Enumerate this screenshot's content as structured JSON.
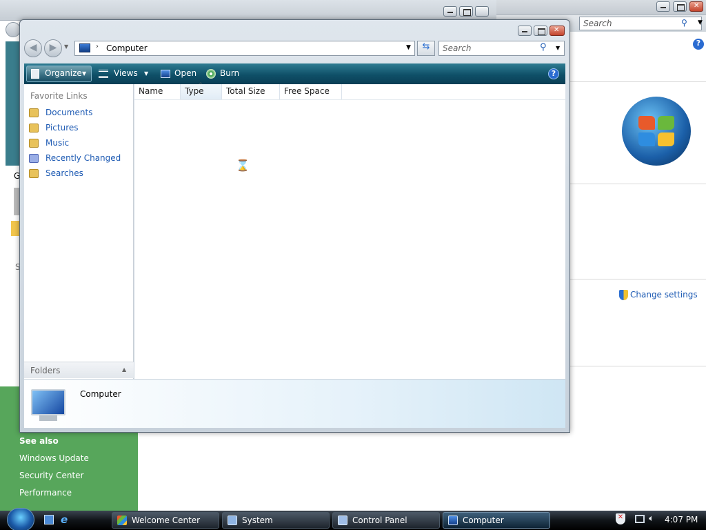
{
  "background_window": {
    "search_placeholder": "Search",
    "change_settings": "Change settings"
  },
  "back_window_left": {
    "letter_g": "G",
    "letter_s": "S"
  },
  "green_panel": {
    "heading": "See also",
    "links": [
      "Windows Update",
      "Security Center",
      "Performance"
    ]
  },
  "explorer": {
    "address": "Computer",
    "search_placeholder": "Search",
    "commands": {
      "organize": "Organize",
      "views": "Views",
      "open": "Open",
      "burn": "Burn"
    },
    "favorite_links_heading": "Favorite Links",
    "favorite_links": [
      "Documents",
      "Pictures",
      "Music",
      "Recently Changed",
      "Searches"
    ],
    "folders_label": "Folders",
    "columns": [
      "Name",
      "Type",
      "Total Size",
      "Free Space"
    ],
    "details_title": "Computer"
  },
  "taskbar": {
    "tasks": [
      "Welcome Center",
      "System",
      "Control Panel",
      "Computer"
    ],
    "clock": "4:07 PM"
  },
  "colors": {
    "accent": "#1d5ab3",
    "command_bar": "#0f5068",
    "green_panel": "#57a65b"
  }
}
